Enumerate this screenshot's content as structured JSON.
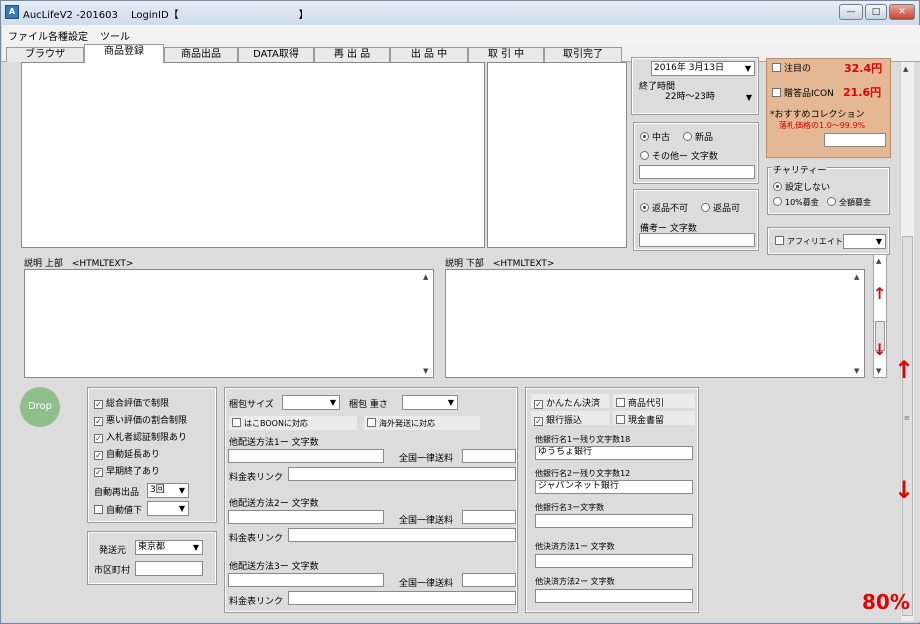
{
  "window": {
    "title": "AucLifeV2 -201603　 LoginID【　　　　　　　　　　　　】",
    "min": "—",
    "max": "□",
    "close": "✕"
  },
  "menu": [
    "ファイル",
    "各種設定",
    "ツール"
  ],
  "tabs": [
    "ブラウザ",
    "商品登録",
    "商品出品",
    "DATA取得",
    "再 出 品",
    "出 品 中",
    "取 引 中",
    "取引完了"
  ],
  "right": {
    "date": "2016年 3月13日",
    "end_time_label": "終了時間",
    "end_time": "22時～23時",
    "condition": {
      "used": "中古",
      "new": "新品",
      "other": "その他ー 文字数"
    },
    "returns": {
      "no": "返品不可",
      "yes": "返品可",
      "note": "備考ー 文字数"
    },
    "featured_label": "注目の",
    "featured_price": "32.4円",
    "gift_label": "贈答品ICON",
    "gift_price": "21.6円",
    "recommend": "*おすすめコレクション",
    "recommend_sub": "落札価格の1.0～99.9%",
    "charity_label": "チャリティー",
    "charity": [
      "設定しない",
      "10%募金",
      "全額募金"
    ],
    "affiliate": "アフィリエイト"
  },
  "desc": {
    "top": "説明 上部　<HTMLTEXT>",
    "bottom": "説明 下部　<HTMLTEXT>"
  },
  "drop": "Drop",
  "rules": {
    "items": [
      "総合評価で制限",
      "悪い評価の割合制限",
      "入札者認証制限あり",
      "自動延長あり",
      "早期終了あり"
    ],
    "relist_label": "自動再出品",
    "relist_value": "3回",
    "discount_label": "自動値下"
  },
  "origin": {
    "label": "発送元",
    "value": "東京都",
    "city": "市区町村"
  },
  "shipping": {
    "size_label": "梱包サイズ",
    "weight_label": "梱包 重さ",
    "hako": "はこBOONに対応",
    "overseas": "海外発送に対応",
    "methods": [
      "他配送方法1ー 文字数",
      "他配送方法2ー 文字数",
      "他配送方法3ー 文字数"
    ],
    "flat": "全国一律送料",
    "link": "料金表リンク"
  },
  "payment": {
    "easy": "かんたん決済",
    "cod": "商品代引",
    "bank": "銀行振込",
    "cash": "現金書留",
    "bank1_label": "他銀行名1ー残り文字数18",
    "bank1_value": "ゆうちょ銀行",
    "bank2_label": "他銀行名2ー残り文字数12",
    "bank2_value": "ジャパンネット銀行",
    "bank3_label": "他銀行名3ー文字数",
    "other1": "他決済方法1ー 文字数",
    "other2": "他決済方法2ー 文字数"
  },
  "zoom": "80%",
  "colors": {
    "accent_red": "#e60000",
    "drop_green": "#8fbf8a",
    "info_panel": "#e4b894"
  }
}
